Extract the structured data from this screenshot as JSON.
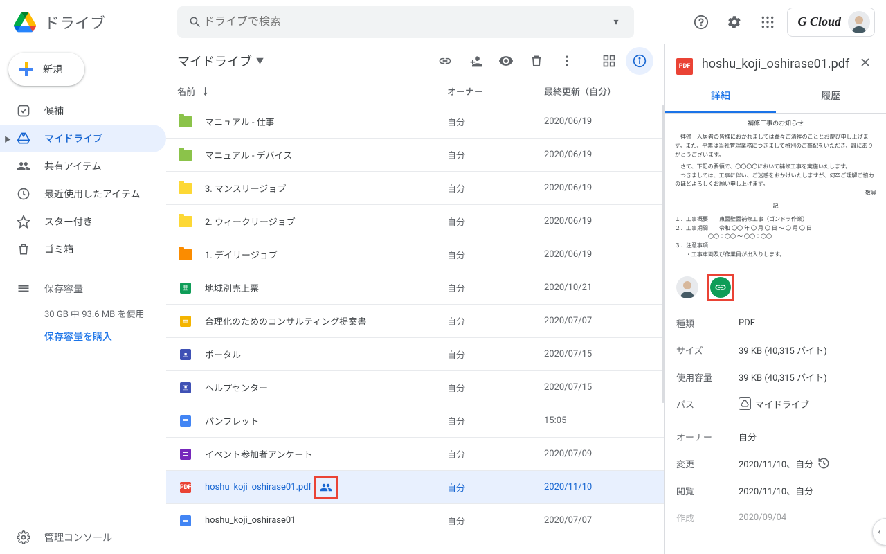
{
  "app": {
    "name": "ドライブ",
    "brand": "G Cloud"
  },
  "search": {
    "placeholder": "ドライブで検索"
  },
  "new_button": "新規",
  "sidebar": {
    "items": [
      {
        "label": "候補"
      },
      {
        "label": "マイドライブ"
      },
      {
        "label": "共有アイテム"
      },
      {
        "label": "最近使用したアイテム"
      },
      {
        "label": "スター付き"
      },
      {
        "label": "ゴミ箱"
      }
    ],
    "storage_label": "保存容量",
    "storage_usage": "30 GB 中 93.6 MB を使用",
    "buy_storage": "保存容量を購入",
    "admin": "管理コンソール"
  },
  "breadcrumb": "マイドライブ",
  "columns": {
    "name": "名前",
    "owner": "オーナー",
    "modified": "最終更新（自分）"
  },
  "files": [
    {
      "icon": "folder",
      "color": "#8bc34a",
      "name": "マニュアル - 仕事",
      "owner": "自分",
      "date": "2020/06/19"
    },
    {
      "icon": "folder",
      "color": "#8bc34a",
      "name": "マニュアル - デバイス",
      "owner": "自分",
      "date": "2020/06/19"
    },
    {
      "icon": "folder",
      "color": "#fdd835",
      "name": "3. マンスリージョブ",
      "owner": "自分",
      "date": "2020/06/19"
    },
    {
      "icon": "folder",
      "color": "#fdd835",
      "name": "2. ウィークリージョブ",
      "owner": "自分",
      "date": "2020/06/19"
    },
    {
      "icon": "folder",
      "color": "#fb8c00",
      "name": "1. デイリージョブ",
      "owner": "自分",
      "date": "2020/06/19"
    },
    {
      "icon": "sheets",
      "color": "#0f9d58",
      "name": "地域別売上票",
      "owner": "自分",
      "date": "2020/10/21"
    },
    {
      "icon": "slides",
      "color": "#f4b400",
      "name": "合理化のためのコンサルティング提案書",
      "owner": "自分",
      "date": "2020/07/07"
    },
    {
      "icon": "sites",
      "color": "#3f51b5",
      "name": "ポータル",
      "owner": "自分",
      "date": "2020/07/15"
    },
    {
      "icon": "sites",
      "color": "#3f51b5",
      "name": "ヘルプセンター",
      "owner": "自分",
      "date": "2020/07/15"
    },
    {
      "icon": "docs",
      "color": "#4285f4",
      "name": "パンフレット",
      "owner": "自分",
      "date": "15:05"
    },
    {
      "icon": "forms",
      "color": "#7627bb",
      "name": "イベント参加者アンケート",
      "owner": "自分",
      "date": "2020/07/09"
    },
    {
      "icon": "pdf",
      "color": "#ea4335",
      "name": "hoshu_koji_oshirase01.pdf",
      "owner": "自分",
      "date": "2020/11/10",
      "selected": true,
      "shared": true
    },
    {
      "icon": "docs",
      "color": "#4285f4",
      "name": "hoshu_koji_oshirase01",
      "owner": "自分",
      "date": "2020/07/07"
    }
  ],
  "details": {
    "title": "hoshu_koji_oshirase01.pdf",
    "tabs": {
      "details": "詳細",
      "activity": "履歴"
    },
    "preview": {
      "title": "補修工事のお知らせ",
      "p1": "拝啓　入居者の皆様におかれましては益々ご清祥のこととお慶び申し上げます。また、平素は当社管理業務につきまして格別のご高配をいただき、誠にありがとうございます。",
      "p2": "さて、下記の要領で、〇〇〇〇において補修工事を実施いたします。",
      "p3": "つきましては、工事に伴い、ご迷惑をおかけいたしますが、何卒ご理解ご協力のほどよろしくお願い申し上げます。",
      "p4": "敬具",
      "p5": "記",
      "i1": "１．工事概要　　東面壁面補修工事（ゴンドラ作業）",
      "i2": "２．工事期間　　令和 〇〇 年 〇 月 〇 日 〜 〇 月 〇 日",
      "i2b": "〇〇：〇〇 〜 〇〇：〇〇",
      "i3": "３．注意事項",
      "i3b": "・工事車両及び作業員が出入りします。"
    },
    "meta": {
      "type_l": "種類",
      "type_v": "PDF",
      "size_l": "サイズ",
      "size_v": "39 KB (40,315 バイト)",
      "used_l": "使用容量",
      "used_v": "39 KB (40,315 バイト)",
      "path_l": "パス",
      "path_v": "マイドライブ",
      "owner_l": "オーナー",
      "owner_v": "自分",
      "mod_l": "変更",
      "mod_v": "2020/11/10、自分",
      "view_l": "閲覧",
      "view_v": "2020/11/10、自分",
      "created_l": "作成",
      "created_v": "2020/09/04"
    }
  }
}
